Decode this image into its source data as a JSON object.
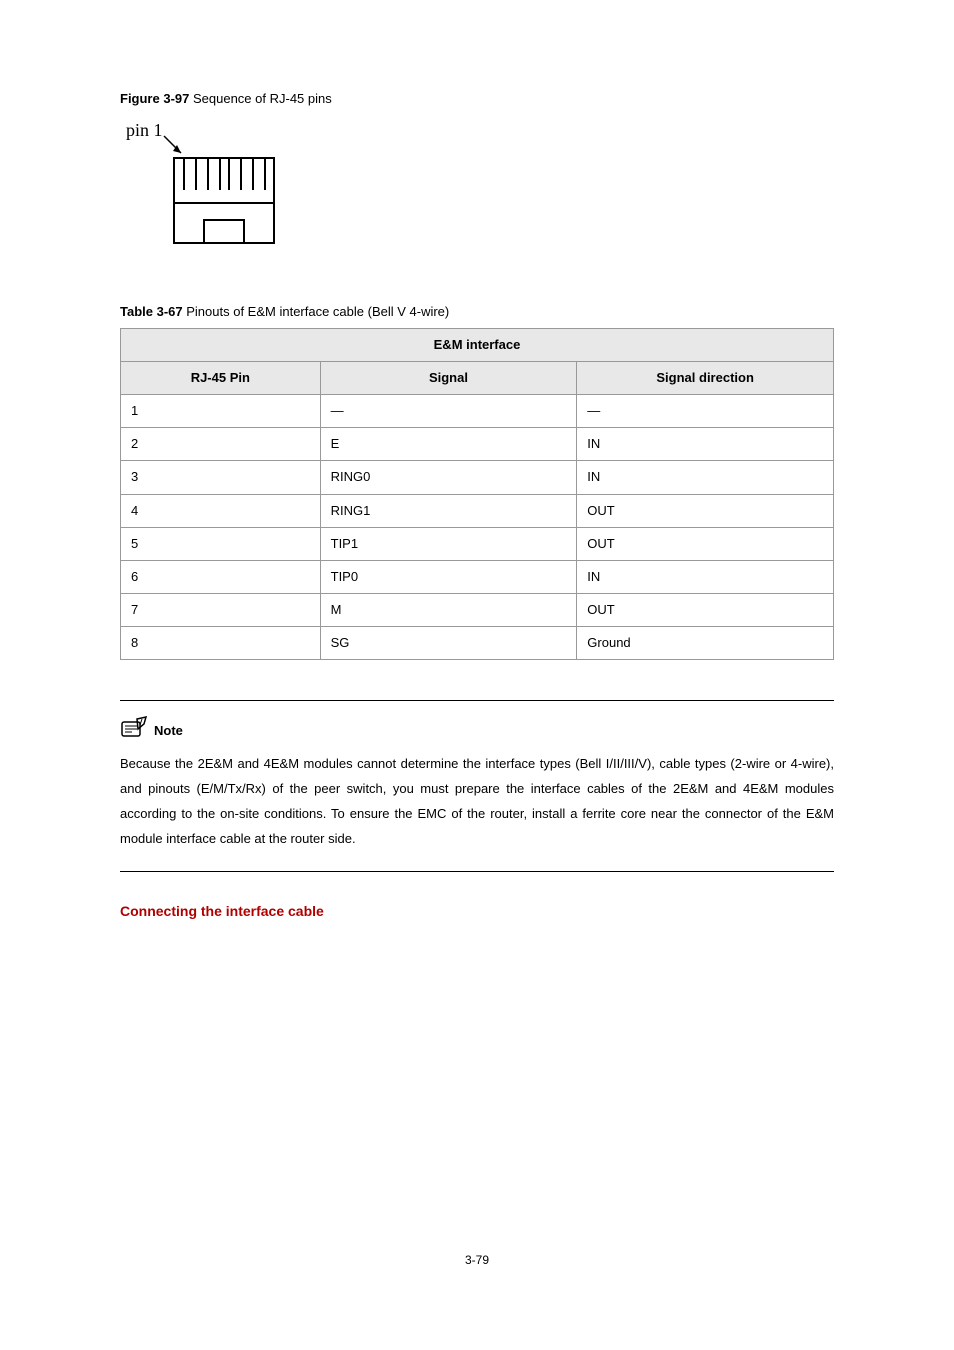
{
  "figure": {
    "label": "Figure 3-97",
    "text": "Sequence of RJ-45 pins",
    "pin_label": "pin 1"
  },
  "table": {
    "label": "Table 3-67",
    "text": "Pinouts of E&M interface cable (Bell V 4-wire)",
    "header_main": "E&M interface",
    "header_col1": "RJ-45 Pin",
    "header_col2": "Signal",
    "header_col3": "Signal direction",
    "rows": [
      {
        "pin": "1",
        "signal": "—",
        "dir": "—"
      },
      {
        "pin": "2",
        "signal": "E",
        "dir": "IN"
      },
      {
        "pin": "3",
        "signal": "RING0",
        "dir": "IN"
      },
      {
        "pin": "4",
        "signal": "RING1",
        "dir": "OUT"
      },
      {
        "pin": "5",
        "signal": "TIP1",
        "dir": "OUT"
      },
      {
        "pin": "6",
        "signal": "TIP0",
        "dir": "IN"
      },
      {
        "pin": "7",
        "signal": "M",
        "dir": "OUT"
      },
      {
        "pin": "8",
        "signal": "SG",
        "dir": "Ground"
      }
    ]
  },
  "note": {
    "label": "Note",
    "body": "Because the 2E&M and 4E&M modules cannot determine the interface types (Bell I/II/III/V), cable types (2-wire or 4-wire), and pinouts (E/M/Tx/Rx) of the peer switch, you must prepare the interface cables of the 2E&M and 4E&M modules according to the on-site conditions. To ensure the EMC of the router, install a ferrite core near the connector of the E&M module interface cable at the router side."
  },
  "section_heading": "Connecting the interface cable",
  "page_number": "3-79"
}
